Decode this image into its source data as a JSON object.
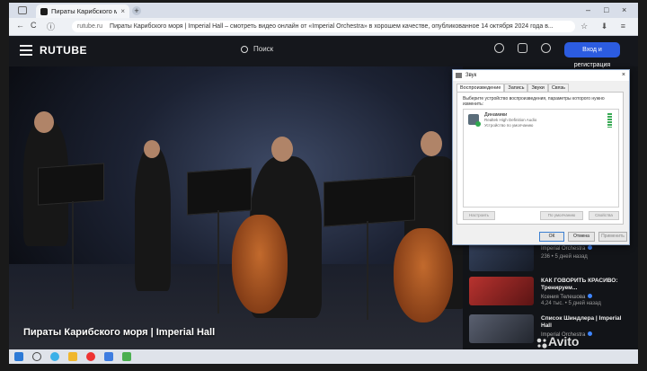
{
  "browser": {
    "tab_title": "Пираты Карибского моря | Imperial Hall",
    "tab_close": "×",
    "new_tab": "+",
    "window_controls": [
      "–",
      "□",
      "×"
    ],
    "domain": "rutube.ru",
    "page_title_in_bar": "Пираты Карибского моря | Imperial Hall – смотреть видео онлайн от «Imperial Orchestra» в хорошем качестве, опубликованное 14 октября 2024 года в...",
    "nav": {
      "back": "←",
      "reload": "C",
      "shield": "ⓘ"
    }
  },
  "site": {
    "logo": "RUTUBE",
    "search_label": "Поиск",
    "login_button": "Вход и регистрация"
  },
  "video": {
    "title": "Пираты Карибского моря | Imperial Hall"
  },
  "sidebar": {
    "cards": [
      {
        "title": "",
        "author": "Imperial Orchestra",
        "meta": "236 • 5 дней назад"
      },
      {
        "title": "КАК ГОВОРИТЬ КРАСИВО: Тренируем...",
        "author": "Ксения Телешова",
        "meta": "4,24 тыс. • 5 дней назад"
      },
      {
        "title": "Список Шиндлера | Imperial Hall",
        "author": "Imperial Orchestra",
        "meta": ""
      }
    ]
  },
  "sound_dialog": {
    "title": "Звук",
    "close": "×",
    "tabs": [
      "Воспроизведение",
      "Запись",
      "Звуки",
      "Связь"
    ],
    "description": "Выберите устройство воспроизведения, параметры которого нужно изменить:",
    "device": {
      "name": "Динамики",
      "driver": "Realtek High Definition Audio",
      "status": "Устройство по умолчанию"
    },
    "configure_button": "Настроить",
    "default_button": "По умолчанию",
    "properties_button": "Свойства",
    "ok": "ОК",
    "cancel": "Отмена",
    "apply": "Применить"
  },
  "watermark": {
    "text": "Avito"
  },
  "colors": {
    "accent": "#2c5ce0",
    "header_bg": "#15171c"
  }
}
